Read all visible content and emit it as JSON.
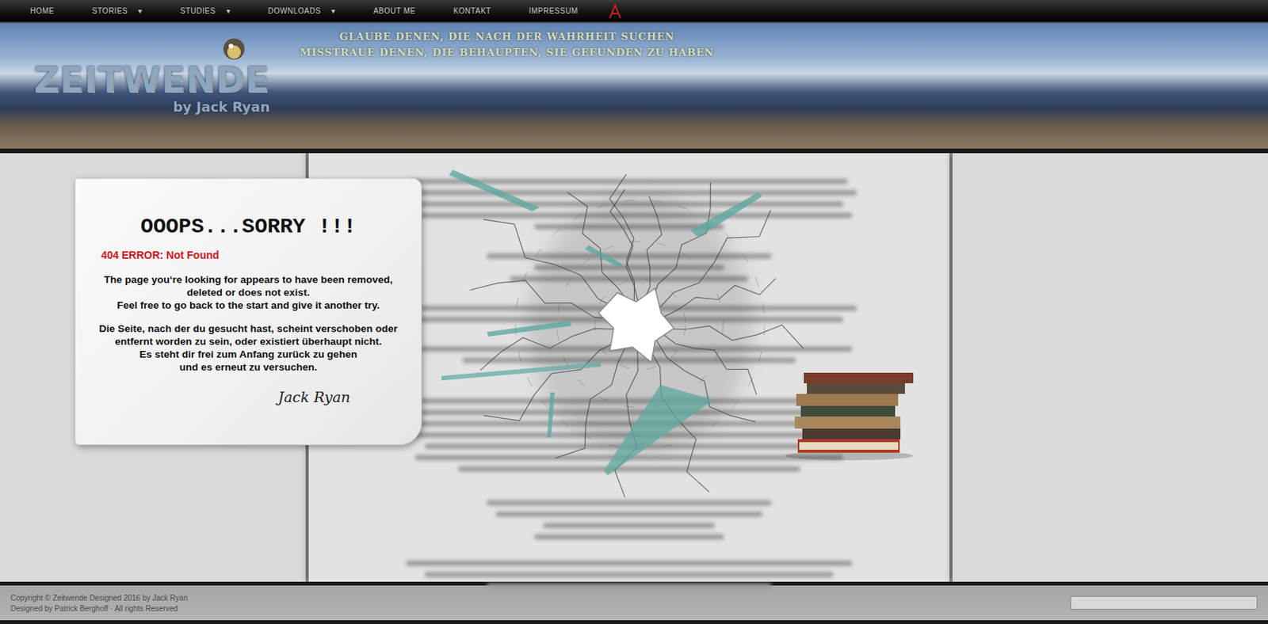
{
  "nav": [
    {
      "label": "HOME",
      "caret": ""
    },
    {
      "label": "STORIES",
      "caret": "▾"
    },
    {
      "label": "STUDIES",
      "caret": "▾"
    },
    {
      "label": "DOWNLOADS",
      "caret": "▾"
    },
    {
      "label": "ABOUT ME",
      "caret": ""
    },
    {
      "label": "KONTAKT",
      "caret": ""
    },
    {
      "label": "IMPRESSUM",
      "caret": ""
    }
  ],
  "header": {
    "logo": "ZEITWENDE",
    "byline": "by Jack Ryan",
    "tagline": [
      "GLAUBE DENEN, DIE NACH DER WAHRHEIT SUCHEN",
      "MISSTRAUE DENEN, DIE BEHAUPTEN, SIE GEFUNDEN ZU HABEN"
    ]
  },
  "error": {
    "title": "OOOPS...SORRY !!!",
    "code": "404 ERROR: Not Found",
    "english": [
      "The page you‘re looking for appears to have been removed,",
      "deleted or does not exist.",
      "Feel free to go back to the start and give it another try."
    ],
    "german": [
      "Die Seite, nach der du gesucht hast, scheint verschoben oder",
      "entfernt worden zu sein, oder existiert überhaupt nicht.",
      "Es steht dir frei zum Anfang zurück zu gehen",
      "und es erneut zu versuchen."
    ],
    "signature": "Jack Ryan"
  },
  "footer": {
    "lines": [
      "Copyright © Zeitwende Designed 2016 by Jack Ryan",
      "Designed by Patrick Berghoff · All rights Reserved"
    ]
  }
}
